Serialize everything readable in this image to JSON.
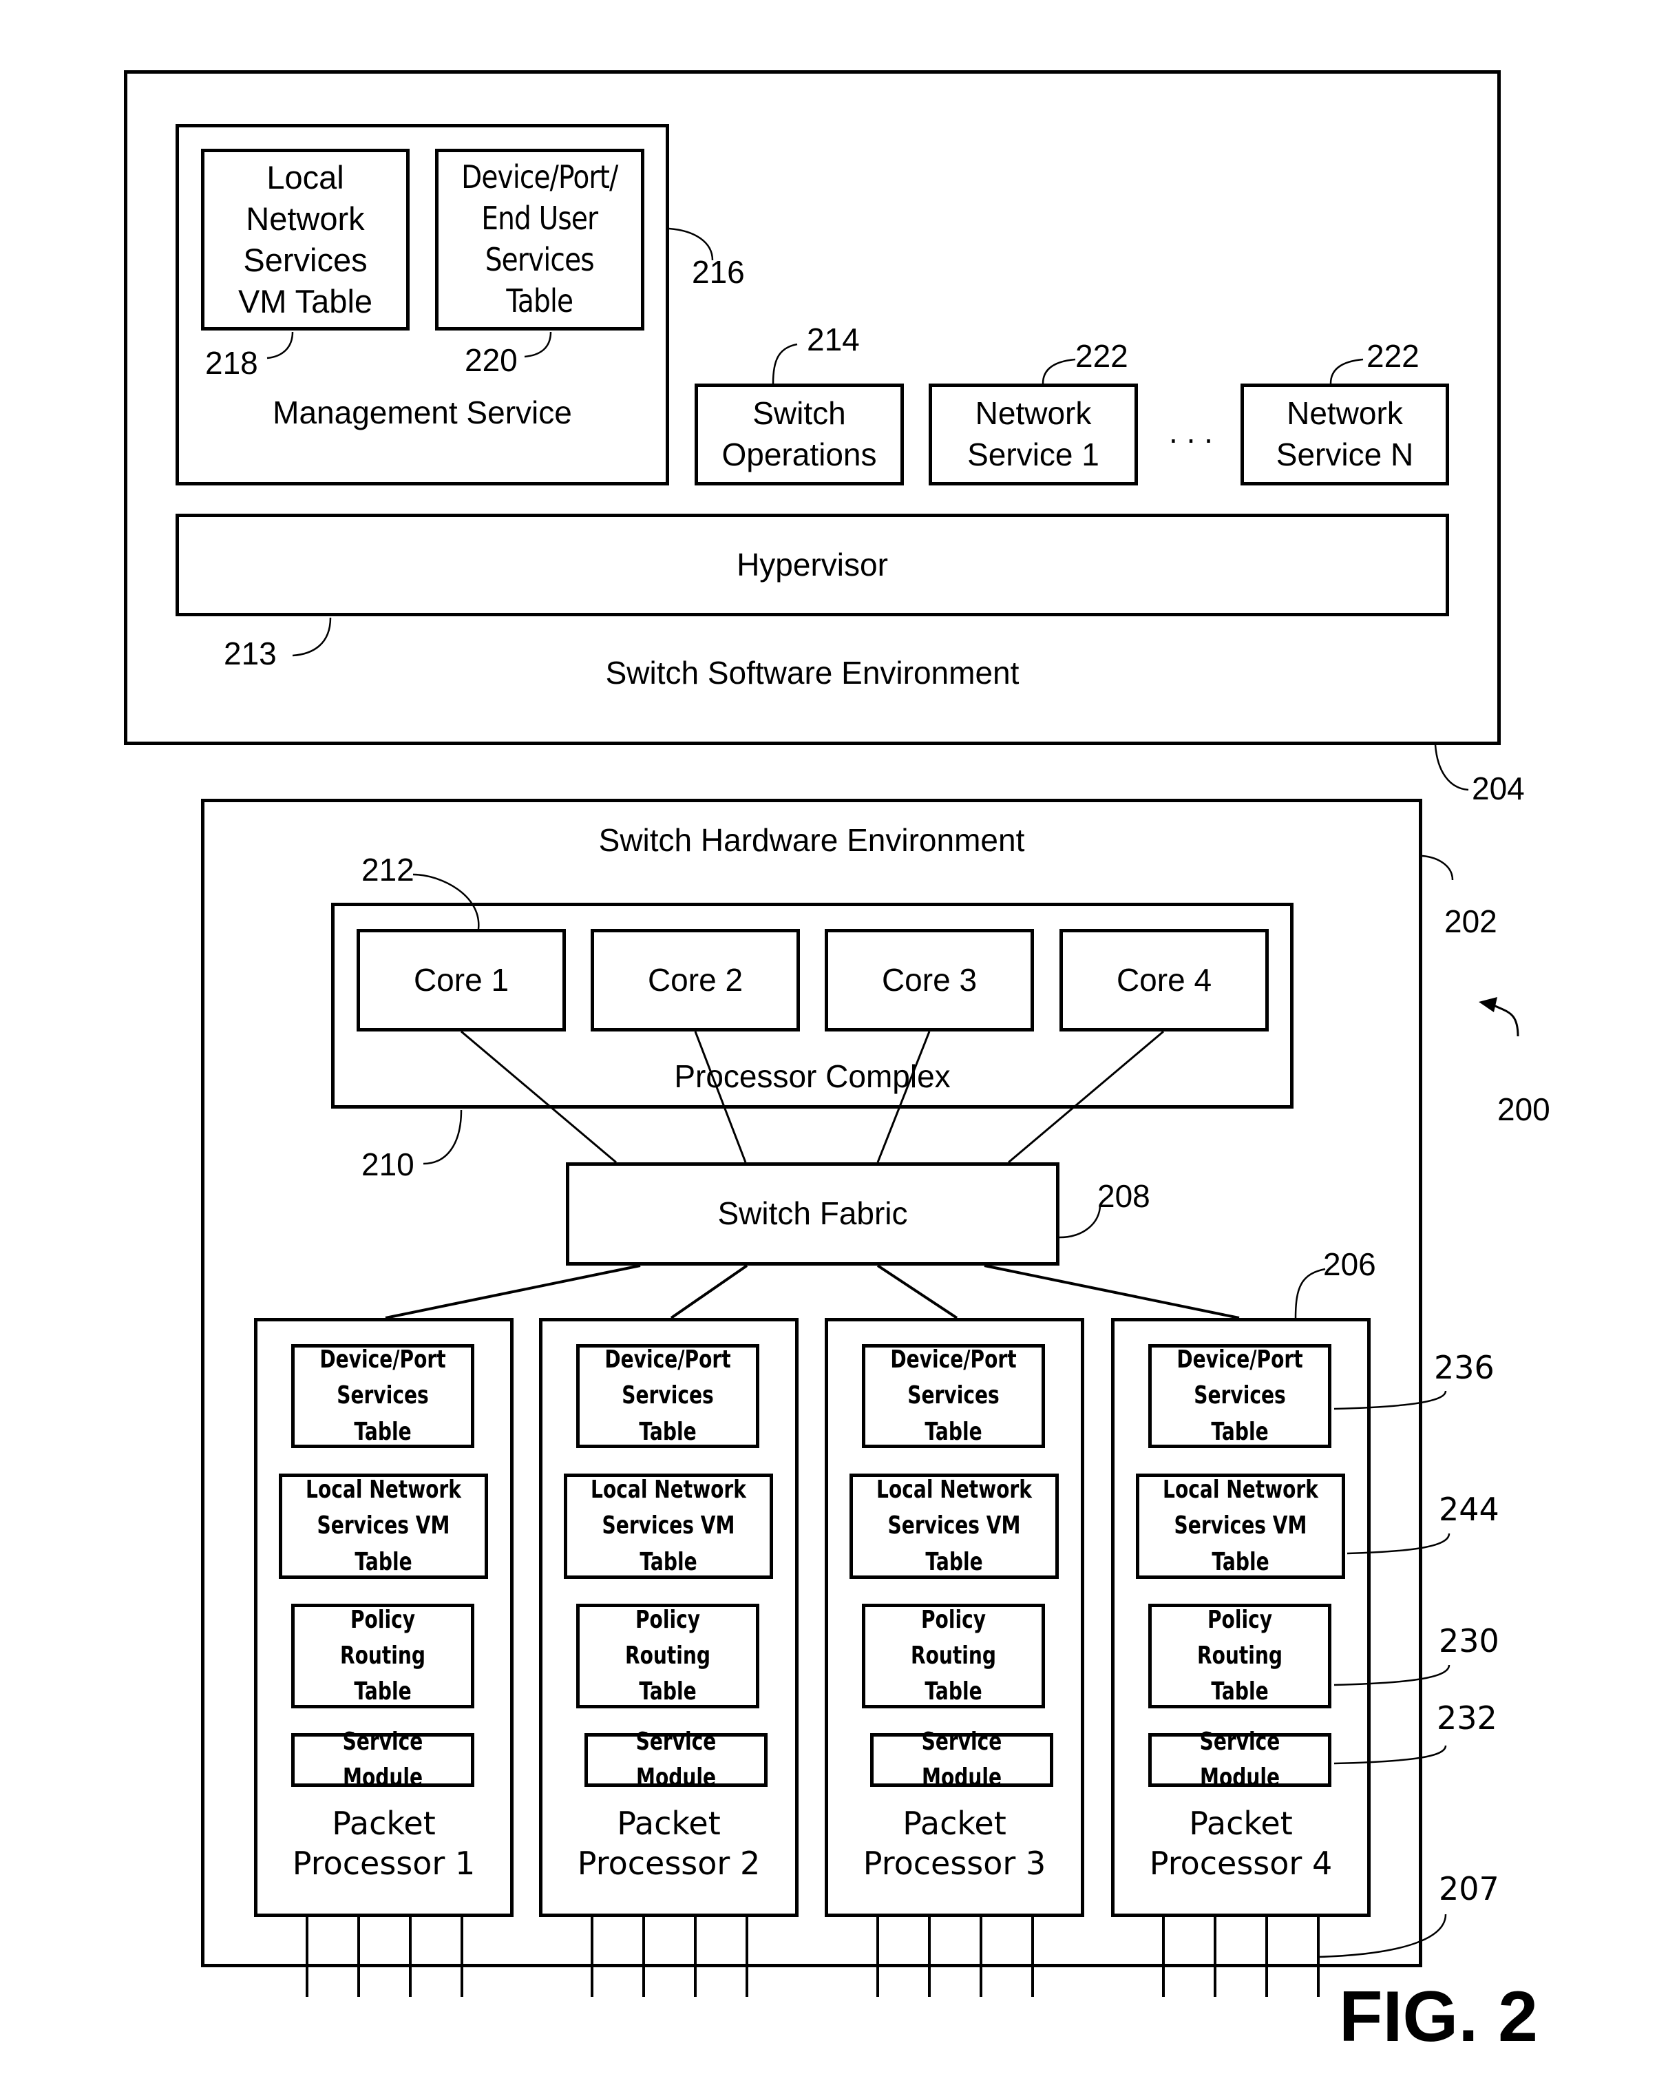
{
  "figure_label": "FIG. 2",
  "system_ref": "200",
  "software_environment": {
    "label": "Switch Software Environment",
    "ref": "204",
    "management_service": {
      "label": "Management Service",
      "ref": "216",
      "tables": [
        {
          "label": "Local\nNetwork\nServices\nVM Table",
          "ref": "218"
        },
        {
          "label": "Device/Port/\nEnd User\nServices\nTable",
          "ref": "220"
        }
      ]
    },
    "switch_operations": {
      "label": "Switch\nOperations",
      "ref": "214"
    },
    "network_services": [
      {
        "label": "Network\nService 1",
        "ref": "222"
      },
      {
        "label": "Network\nService N",
        "ref": "222"
      }
    ],
    "ellipsis": ". . .",
    "hypervisor": {
      "label": "Hypervisor",
      "ref": "213"
    }
  },
  "hardware_environment": {
    "label": "Switch Hardware Environment",
    "ref": "202",
    "processor_complex": {
      "label": "Processor Complex",
      "ref": "210",
      "cores_ref": "212",
      "cores": [
        "Core 1",
        "Core 2",
        "Core 3",
        "Core 4"
      ]
    },
    "switch_fabric": {
      "label": "Switch Fabric",
      "ref": "208"
    },
    "packet_processors_ref": "206",
    "ports_ref": "207",
    "packet_processors": [
      {
        "label": "Packet\nProcessor 1"
      },
      {
        "label": "Packet\nProcessor 2"
      },
      {
        "label": "Packet\nProcessor 3"
      },
      {
        "label": "Packet\nProcessor 4"
      }
    ],
    "pp_components": [
      {
        "label": "Device/Port\nServices Table",
        "ref": "236"
      },
      {
        "label": "Local Network\nServices VM Table",
        "ref": "244"
      },
      {
        "label": "Policy Routing\nTable",
        "ref": "230"
      },
      {
        "label": "Service Module",
        "ref": "232"
      }
    ]
  }
}
